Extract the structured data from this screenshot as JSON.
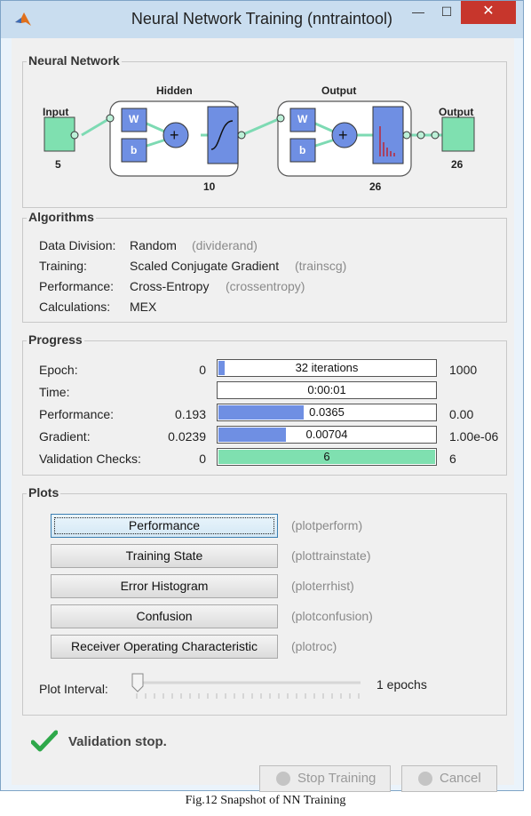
{
  "window": {
    "title": "Neural Network Training (nntraintool)",
    "minimize": "—",
    "maximize": "☐",
    "close": "✕"
  },
  "network": {
    "section_title": "Neural Network",
    "input_label": "Input",
    "input_size": "5",
    "hidden_label": "Hidden",
    "hidden_size": "10",
    "output_layer_label": "Output",
    "output_layer_size": "26",
    "output_label": "Output",
    "output_size": "26",
    "w": "W",
    "b": "b"
  },
  "algorithms": {
    "section_title": "Algorithms",
    "rows": [
      {
        "label": "Data Division:",
        "value": "Random",
        "fn": "(dividerand)"
      },
      {
        "label": "Training:",
        "value": "Scaled Conjugate Gradient",
        "fn": "(trainscg)"
      },
      {
        "label": "Performance:",
        "value": "Cross-Entropy",
        "fn": "(crossentropy)"
      },
      {
        "label": "Calculations:",
        "value": "MEX",
        "fn": ""
      }
    ]
  },
  "progress": {
    "section_title": "Progress",
    "rows": [
      {
        "label": "Epoch:",
        "start": "0",
        "text": "32 iterations",
        "end": "1000",
        "fraction": 0.032
      },
      {
        "label": "Time:",
        "start": "",
        "text": "0:00:01",
        "end": "",
        "fraction": 0
      },
      {
        "label": "Performance:",
        "start": "0.193",
        "text": "0.0365",
        "end": "0.00",
        "fraction": 0.39
      },
      {
        "label": "Gradient:",
        "start": "0.0239",
        "text": "0.00704",
        "end": "1.00e-06",
        "fraction": 0.31
      },
      {
        "label": "Validation Checks:",
        "start": "0",
        "text": "6",
        "end": "6",
        "fraction": 1.0
      }
    ],
    "colors": {
      "bar": "#6f8fe3",
      "validation": "#7fe0b0"
    }
  },
  "plots": {
    "section_title": "Plots",
    "buttons": [
      {
        "label": "Performance",
        "fn": "(plotperform)"
      },
      {
        "label": "Training State",
        "fn": "(plottrainstate)"
      },
      {
        "label": "Error Histogram",
        "fn": "(ploterrhist)"
      },
      {
        "label": "Confusion",
        "fn": "(plotconfusion)"
      },
      {
        "label": "Receiver Operating Characteristic",
        "fn": "(plotroc)"
      }
    ],
    "interval_label": "Plot Interval:",
    "interval_value": "1 epochs",
    "slider_fraction": 0
  },
  "status": {
    "message": "Validation stop.",
    "icon": "checkmark-icon",
    "color": "#2ea84a"
  },
  "footer": {
    "stop_label": "Stop Training",
    "cancel_label": "Cancel"
  },
  "caption": "Fig.12 Snapshot of NN Training"
}
